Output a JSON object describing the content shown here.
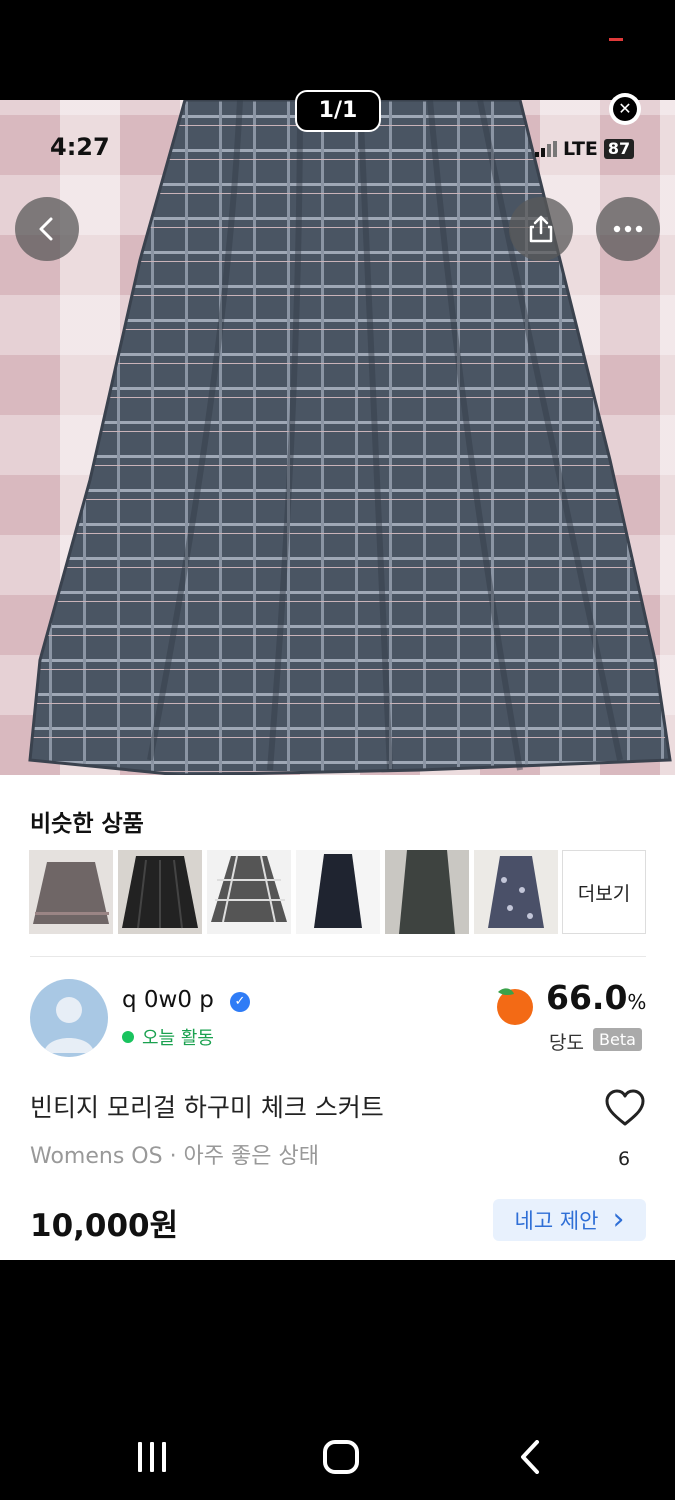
{
  "viewer": {
    "counter": "1/1",
    "close_icon": "close-icon"
  },
  "status_bar": {
    "time": "4:27",
    "network": "LTE",
    "battery": "87"
  },
  "similar": {
    "title": "비슷한 상품",
    "more_label": "더보기",
    "thumbnails": [
      "skirt-gray",
      "skirt-black-pleated",
      "skirt-plaid",
      "skirt-black-long",
      "skirt-dark-long",
      "skirt-print"
    ]
  },
  "seller": {
    "nickname": "q 0w0 p",
    "activity": "오늘 활동",
    "rating_value": "66.0",
    "rating_unit": "%",
    "rating_label": "당도",
    "rating_badge": "Beta"
  },
  "product": {
    "title": "빈티지 모리걸 하구미 체크 스커트",
    "meta": "Womens OS · 아주 좋은 상태",
    "likes": "6",
    "price": "10,000원",
    "offer_label": "네고 제안",
    "offer_chevron": "›"
  },
  "colors": {
    "active_green": "#19c35e",
    "accent_blue": "#2f6fd6",
    "verified_blue": "#2f7cf6"
  }
}
